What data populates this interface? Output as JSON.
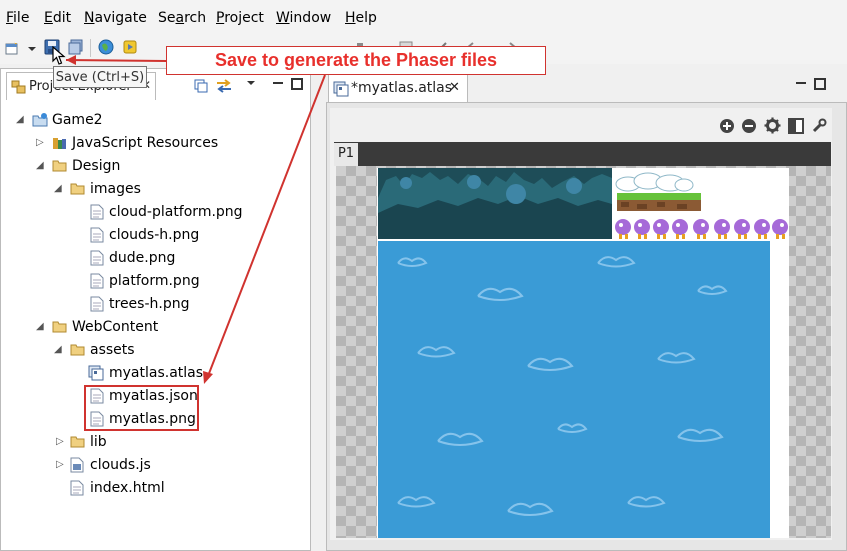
{
  "menu": {
    "items": [
      {
        "mn": "F",
        "rest": "ile"
      },
      {
        "mn": "E",
        "rest": "dit"
      },
      {
        "mn": "N",
        "rest": "avigate"
      },
      {
        "pre": "Se",
        "mn": "a",
        "rest": "rch"
      },
      {
        "mn": "P",
        "rest": "roject"
      },
      {
        "mn": "W",
        "rest": "indow"
      },
      {
        "mn": "H",
        "rest": "elp"
      }
    ]
  },
  "tooltip": {
    "text": "Save (Ctrl+S)"
  },
  "callout": {
    "text": "Save to generate the Phaser files"
  },
  "left_panel": {
    "tab_label": "Project Explorer"
  },
  "tree": {
    "game2": "Game2",
    "js_resources": "JavaScript Resources",
    "design": "Design",
    "images": "images",
    "cloud_platform": "cloud-platform.png",
    "clouds_h": "clouds-h.png",
    "dude": "dude.png",
    "platform": "platform.png",
    "trees_h": "trees-h.png",
    "webcontent": "WebContent",
    "assets": "assets",
    "myatlas_atlas": "myatlas.atlas",
    "myatlas_json": "myatlas.json",
    "myatlas_png": "myatlas.png",
    "lib": "lib",
    "clouds_js": "clouds.js",
    "index_html": "index.html"
  },
  "editor": {
    "tab_label": "*myatlas.atlas",
    "page_tab": "P1"
  },
  "colors": {
    "accent_red": "#d0332f",
    "trees_dark": "#1e4d58",
    "sky_blue": "#3a9bd6"
  }
}
